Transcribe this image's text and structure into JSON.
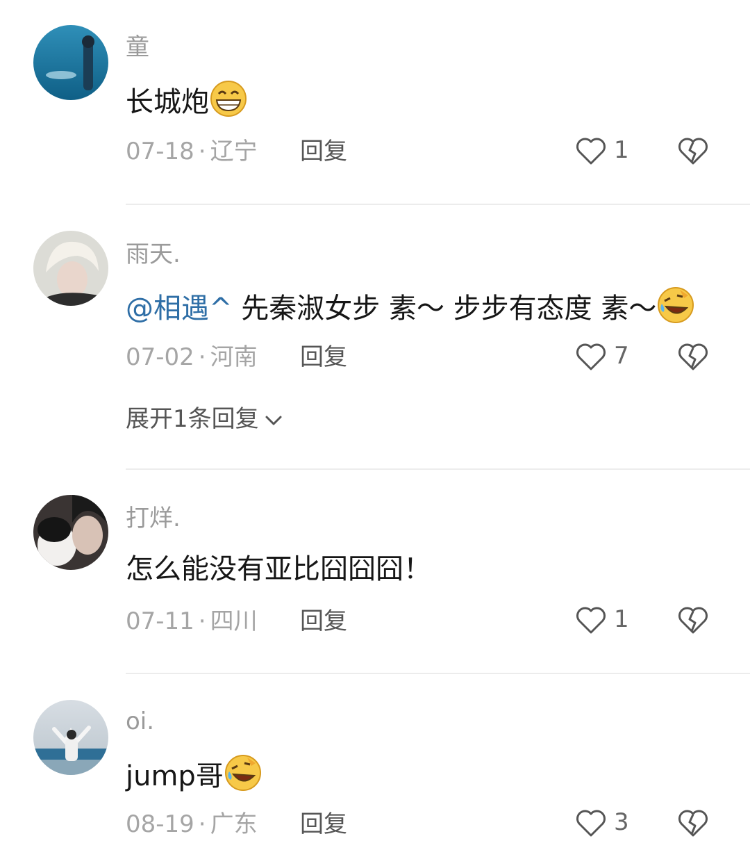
{
  "comments": [
    {
      "username": "童",
      "text": "长城炮",
      "emoji": "grinning-face-emoji",
      "date": "07-18",
      "location": "辽宁",
      "reply_label": "回复",
      "likes": "1"
    },
    {
      "username": "雨天.",
      "mention": "@相遇^",
      "text": " 先秦淑女步 素～ 步步有态度 素～",
      "emoji": "rofl-emoji",
      "date": "07-02",
      "location": "河南",
      "reply_label": "回复",
      "likes": "7",
      "expand_label": "展开1条回复"
    },
    {
      "username": "打烊.",
      "text": "怎么能没有亚比囧囧囧！",
      "date": "07-11",
      "location": "四川",
      "reply_label": "回复",
      "likes": "1"
    },
    {
      "username": "oi.",
      "text": "jump哥",
      "emoji": "rofl-emoji",
      "date": "08-19",
      "location": "广东",
      "reply_label": "回复",
      "likes": "3"
    }
  ],
  "separator": "·",
  "icons": {
    "like": "heart-outline-icon",
    "dislike": "broken-heart-icon",
    "expand": "chevron-down-icon"
  },
  "colors": {
    "mention": "#2e6ea6",
    "meta": "#a5a5a5",
    "text": "#161616"
  }
}
